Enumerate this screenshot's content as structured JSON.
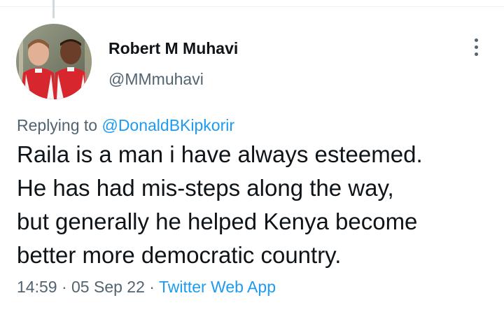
{
  "author": {
    "display_name": "Robert M Muhavi",
    "handle": "@MMmuhavi",
    "avatar_icon": "profile-photo"
  },
  "more_icon": "more-options-icon",
  "reply_context": {
    "prefix": "Replying to",
    "mention": "@DonaldBKipkorir"
  },
  "tweet": {
    "lines": [
      "Raila is a man i have always esteemed.",
      "He has had mis-steps along the way,",
      "but generally he helped Kenya become",
      "better more democratic country."
    ]
  },
  "meta": {
    "time": "14:59",
    "separator": "·",
    "date": "05 Sep 22",
    "source": "Twitter Web App"
  },
  "colors": {
    "text_primary": "#0f1419",
    "text_secondary": "#536471",
    "link": "#1d9bf0",
    "divider": "#eff3f4"
  }
}
